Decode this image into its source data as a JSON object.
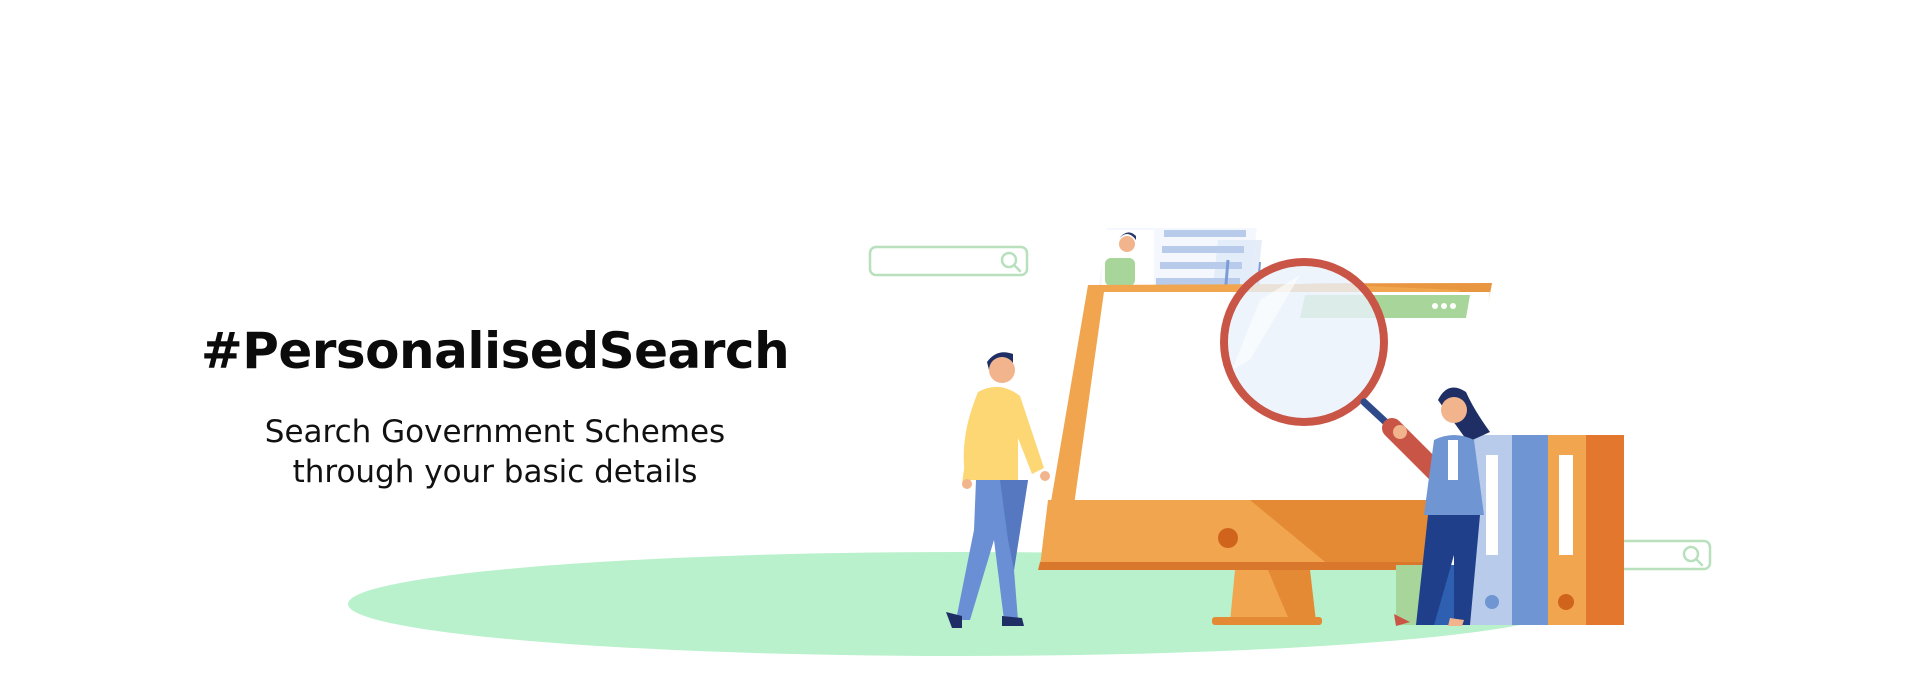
{
  "banner": {
    "headline": "#PersonalisedSearch",
    "subtext_line1": "Search Government Schemes",
    "subtext_line2": "through your basic details"
  },
  "colors": {
    "ground": "#b8f1cc",
    "monitor": "#f0a54e",
    "monitor_dark": "#e48a34",
    "magnifier": "#c95546",
    "document_lines": "#b8cbea",
    "browser_bar": "#a8d69a",
    "search_bar_outline": "#b8e0bd",
    "binder_blue": "#6f96d2",
    "binder_orange": "#e3772d",
    "man_shirt": "#fdd774",
    "man_pants": "#6b8fd4"
  },
  "icons": {
    "search_bar_left": "search-icon",
    "search_bar_right": "search-icon"
  }
}
